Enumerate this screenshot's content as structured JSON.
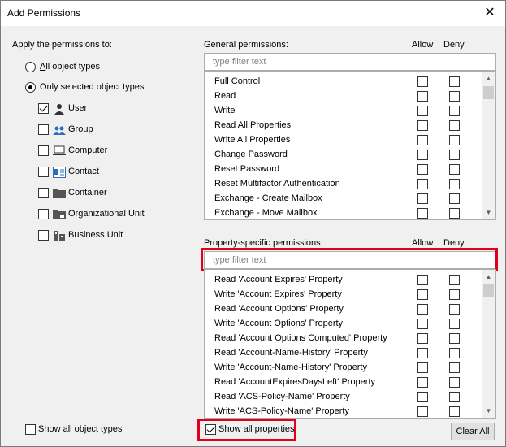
{
  "window": {
    "title": "Add Permissions"
  },
  "apply": {
    "label": "Apply the permissions to:",
    "radio_all": "All object types",
    "radio_selected": "Only selected object types",
    "types": [
      {
        "label": "User",
        "checked": true,
        "icon": "user-icon"
      },
      {
        "label": "Group",
        "checked": false,
        "icon": "group-icon"
      },
      {
        "label": "Computer",
        "checked": false,
        "icon": "computer-icon"
      },
      {
        "label": "Contact",
        "checked": false,
        "icon": "contact-icon"
      },
      {
        "label": "Container",
        "checked": false,
        "icon": "folder-icon"
      },
      {
        "label": "Organizational Unit",
        "checked": false,
        "icon": "ou-folder-icon"
      },
      {
        "label": "Business Unit",
        "checked": false,
        "icon": "business-unit-icon"
      }
    ],
    "show_all_types": "Show all object types"
  },
  "general": {
    "label": "General permissions:",
    "allow": "Allow",
    "deny": "Deny",
    "filter_placeholder": "type filter text",
    "items": [
      "Full Control",
      "Read",
      "Write",
      "Read All Properties",
      "Write All Properties",
      "Change Password",
      "Reset Password",
      "Reset Multifactor Authentication",
      "Exchange - Create Mailbox",
      "Exchange - Move Mailbox"
    ]
  },
  "property": {
    "label": "Property-specific permissions:",
    "allow": "Allow",
    "deny": "Deny",
    "filter_placeholder": "type filter text",
    "items": [
      "Read 'Account Expires' Property",
      "Write 'Account Expires' Property",
      "Read 'Account Options' Property",
      "Write 'Account Options' Property",
      "Read 'Account Options Computed' Property",
      "Read 'Account-Name-History' Property",
      "Write 'Account-Name-History' Property",
      "Read 'AccountExpiresDaysLeft' Property",
      "Read 'ACS-Policy-Name' Property",
      "Write 'ACS-Policy-Name' Property"
    ],
    "show_all_properties": "Show all properties",
    "clear_all": "Clear All"
  },
  "colors": {
    "highlight": "#e0001b"
  }
}
